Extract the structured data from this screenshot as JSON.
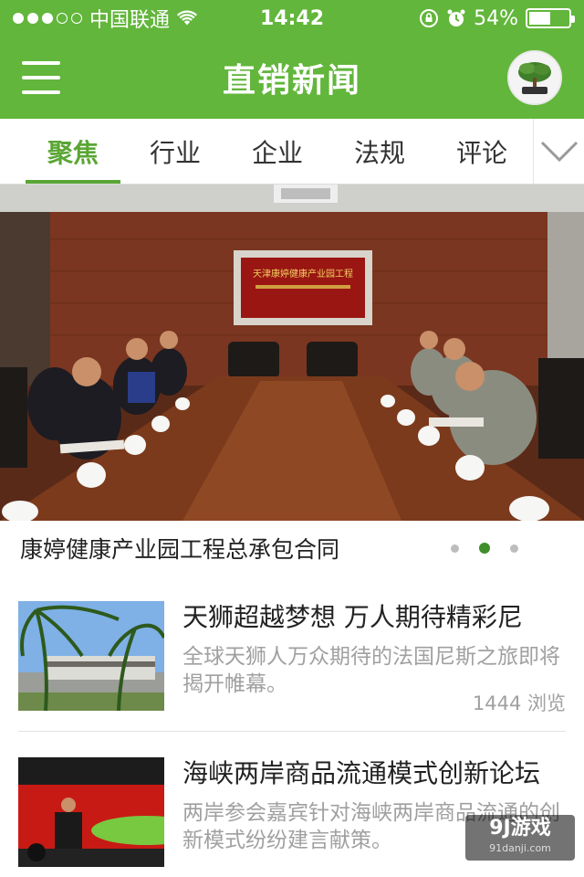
{
  "status_bar": {
    "carrier": "中国联通",
    "time": "14:42",
    "battery": "54%",
    "battery_level": 0.54,
    "signal_dots_filled": 3,
    "signal_dots_total": 5
  },
  "header": {
    "title": "直销新闻"
  },
  "tabs": [
    {
      "label": "聚焦",
      "active": true
    },
    {
      "label": "行业",
      "active": false
    },
    {
      "label": "企业",
      "active": false
    },
    {
      "label": "法规",
      "active": false
    },
    {
      "label": "评论",
      "active": false
    }
  ],
  "banner": {
    "caption": "康婷健康产业园工程总承包合同",
    "page_count": 3,
    "current_page": 2,
    "screen_text": "天津康婷健康产业园工程"
  },
  "news": [
    {
      "title": "天狮超越梦想 万人期待精彩尼",
      "desc": "全球天狮人万众期待的法国尼斯之旅即将揭开帷幕。",
      "views": "1444 浏览"
    },
    {
      "title": "海峡两岸商品流通模式创新论坛",
      "desc": "两岸参会嘉宾针对海峡两岸商品流通的创新模式纷纷建言献策。",
      "views": ""
    }
  ],
  "watermark": {
    "main": "9J游戏",
    "sub": "91danji.com"
  },
  "colors": {
    "brand_green": "#62b63b",
    "active_tab": "#5aa634",
    "muted_text": "#a0a0a0"
  }
}
